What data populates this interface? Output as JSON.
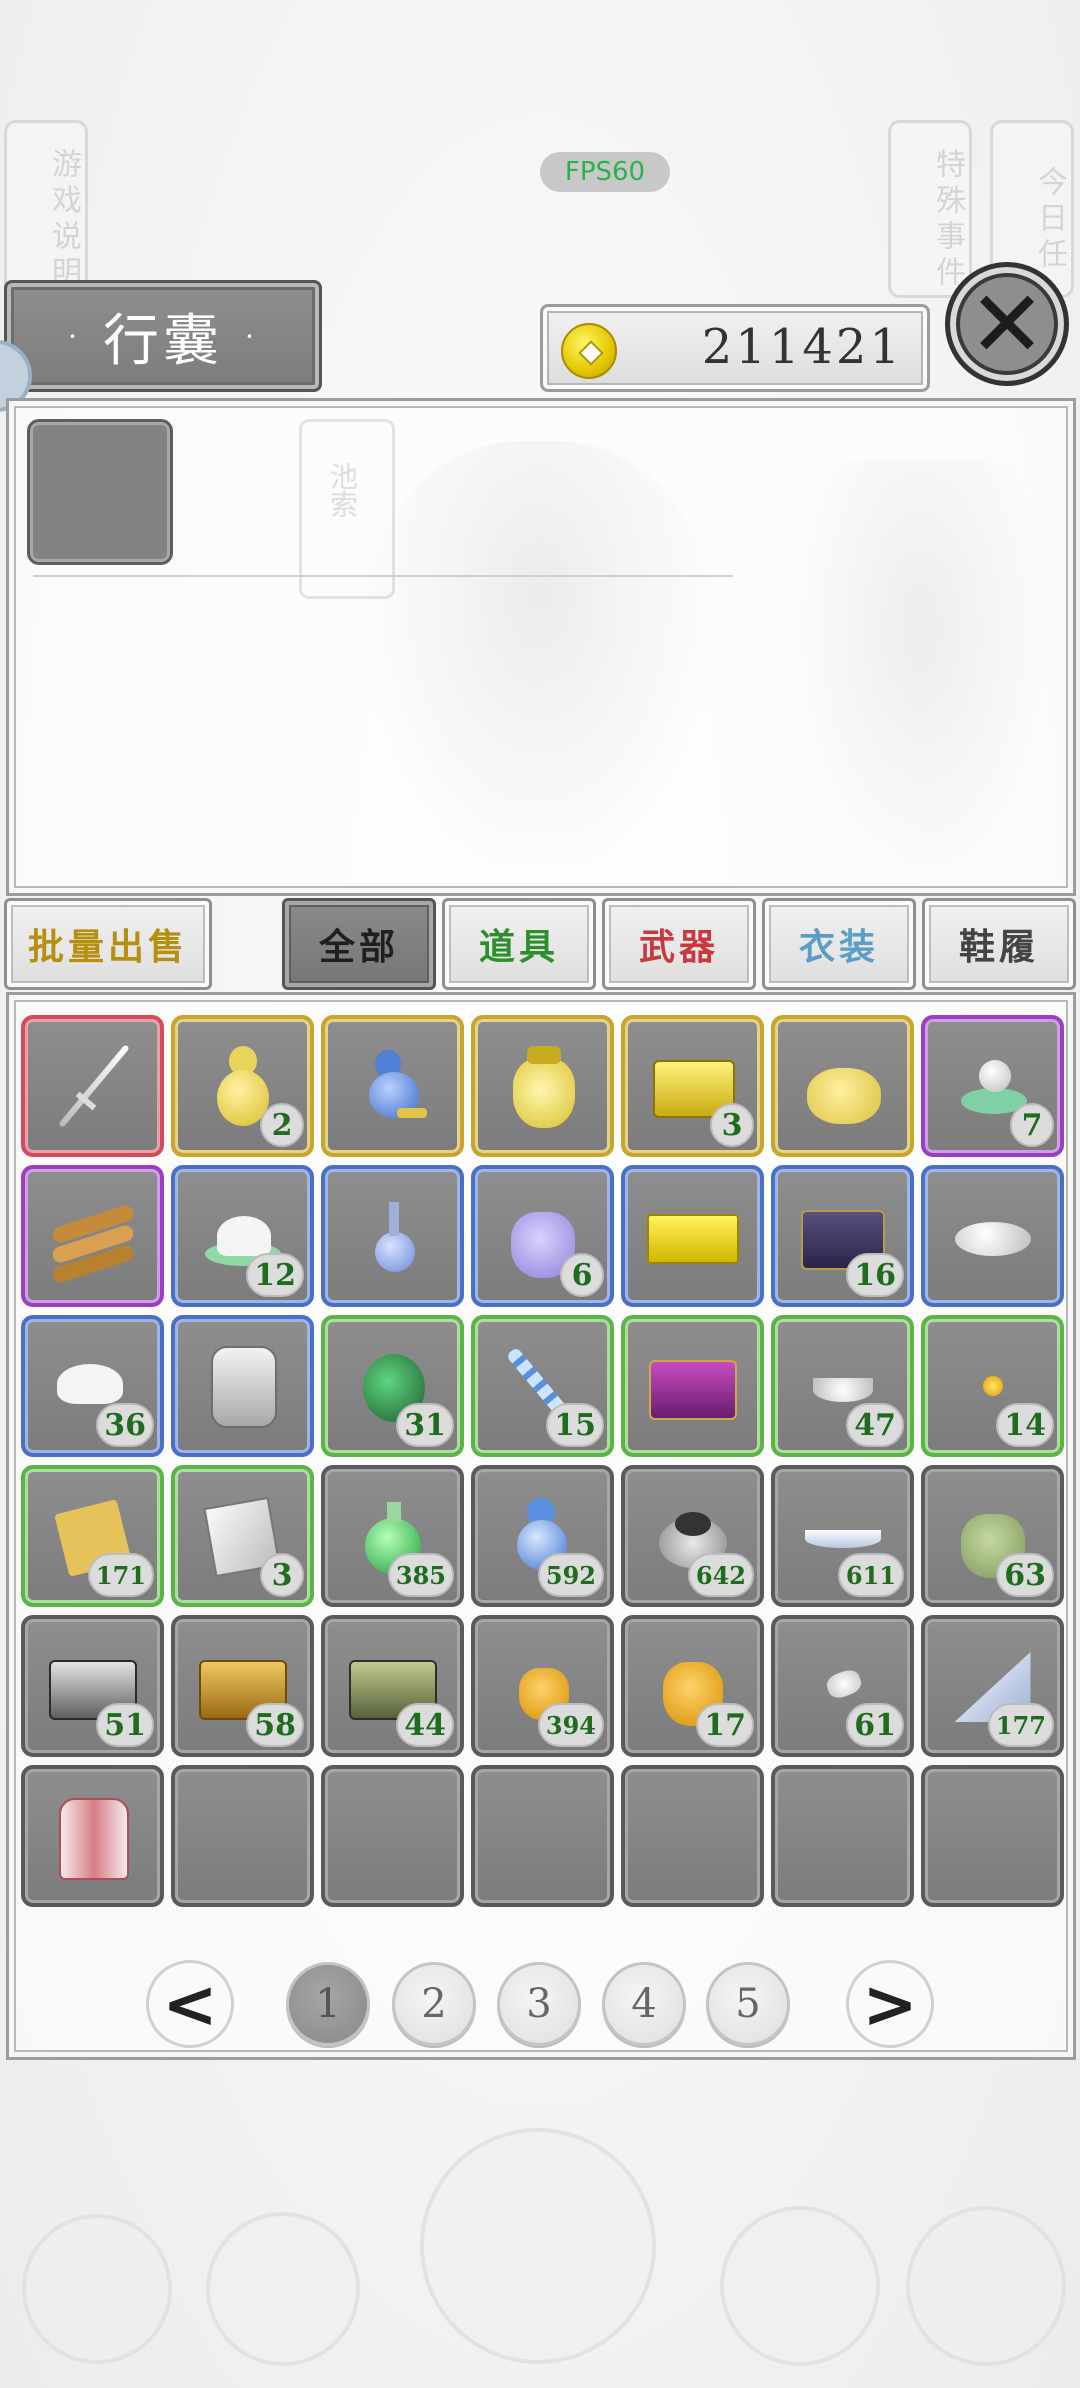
{
  "top": {
    "help_label": "游戏说明",
    "fps": "FPS60",
    "special_label": "特殊事件",
    "daily_label": "今日任"
  },
  "header": {
    "title": "行囊",
    "title_dot": "·",
    "money": "211421"
  },
  "close_glyph": "✕",
  "detail": {
    "bg_seal": "池索"
  },
  "tabs": [
    {
      "label": "批量出售",
      "color": "#b5900f"
    },
    {
      "label": "全部",
      "color": "#1f1f1f"
    },
    {
      "label": "道具",
      "color": "#2c8f2c"
    },
    {
      "label": "武器",
      "color": "#c7393e"
    },
    {
      "label": "衣装",
      "color": "#5a9ec8"
    },
    {
      "label": "鞋履",
      "color": "#444444"
    }
  ],
  "items": [
    {
      "icon": "sword-icon",
      "rarity": "red",
      "count": ""
    },
    {
      "icon": "gold-gourd-icon",
      "rarity": "gold",
      "count": "2"
    },
    {
      "icon": "blue-gourd-icon",
      "rarity": "gold",
      "count": ""
    },
    {
      "icon": "gold-pouch-icon",
      "rarity": "gold",
      "count": ""
    },
    {
      "icon": "gold-chest-icon",
      "rarity": "gold",
      "count": "3"
    },
    {
      "icon": "gold-sack-icon",
      "rarity": "gold",
      "count": ""
    },
    {
      "icon": "pearl-dish-icon",
      "rarity": "purple",
      "count": "7"
    },
    {
      "icon": "bamboo-scroll-icon",
      "rarity": "purple",
      "count": ""
    },
    {
      "icon": "salt-bowl-icon",
      "rarity": "blue",
      "count": "12"
    },
    {
      "icon": "potion-bottle-icon",
      "rarity": "blue",
      "count": ""
    },
    {
      "icon": "purple-pouch-icon",
      "rarity": "blue",
      "count": "6"
    },
    {
      "icon": "yellow-box-icon",
      "rarity": "blue",
      "count": ""
    },
    {
      "icon": "dark-chest-icon",
      "rarity": "blue",
      "count": "16"
    },
    {
      "icon": "silver-ingot-icon",
      "rarity": "blue",
      "count": ""
    },
    {
      "icon": "white-hat-icon",
      "rarity": "blue",
      "count": "36"
    },
    {
      "icon": "armor-icon",
      "rarity": "blue",
      "count": ""
    },
    {
      "icon": "green-jar-icon",
      "rarity": "green",
      "count": "31"
    },
    {
      "icon": "crystal-chain-icon",
      "rarity": "green",
      "count": "15"
    },
    {
      "icon": "purple-chest-icon",
      "rarity": "green",
      "count": ""
    },
    {
      "icon": "silver-boat-icon",
      "rarity": "green",
      "count": "47"
    },
    {
      "icon": "gold-bead-icon",
      "rarity": "green",
      "count": "14"
    },
    {
      "icon": "paper-scroll-icon",
      "rarity": "green",
      "count": "171"
    },
    {
      "icon": "book-icon",
      "rarity": "green",
      "count": "3"
    },
    {
      "icon": "green-potion-icon",
      "rarity": "gray",
      "count": "385"
    },
    {
      "icon": "blue-gourd-small-icon",
      "rarity": "gray",
      "count": "592"
    },
    {
      "icon": "pearl-bowl-icon",
      "rarity": "gray",
      "count": "642"
    },
    {
      "icon": "blue-boat-icon",
      "rarity": "gray",
      "count": "611"
    },
    {
      "icon": "green-sack-icon",
      "rarity": "gray",
      "count": "63"
    },
    {
      "icon": "silver-chest-icon",
      "rarity": "gray",
      "count": "51"
    },
    {
      "icon": "wood-chest-icon",
      "rarity": "gray",
      "count": "58"
    },
    {
      "icon": "green-chest-icon",
      "rarity": "gray",
      "count": "44"
    },
    {
      "icon": "orange-pouch-icon",
      "rarity": "gray",
      "count": "394"
    },
    {
      "icon": "orange-pouch-big-icon",
      "rarity": "gray",
      "count": "17"
    },
    {
      "icon": "silver-shard-icon",
      "rarity": "gray",
      "count": "61"
    },
    {
      "icon": "fan-icon",
      "rarity": "gray",
      "count": "177"
    },
    {
      "icon": "red-robe-icon",
      "rarity": "gray",
      "count": ""
    },
    {
      "icon": "",
      "rarity": "gray",
      "count": ""
    },
    {
      "icon": "",
      "rarity": "gray",
      "count": ""
    },
    {
      "icon": "",
      "rarity": "gray",
      "count": ""
    },
    {
      "icon": "",
      "rarity": "gray",
      "count": ""
    },
    {
      "icon": "",
      "rarity": "gray",
      "count": ""
    },
    {
      "icon": "",
      "rarity": "gray",
      "count": ""
    }
  ],
  "pager": {
    "prev": "<",
    "next": ">",
    "pages": [
      "1",
      "2",
      "3",
      "4",
      "5"
    ],
    "current": "1"
  }
}
